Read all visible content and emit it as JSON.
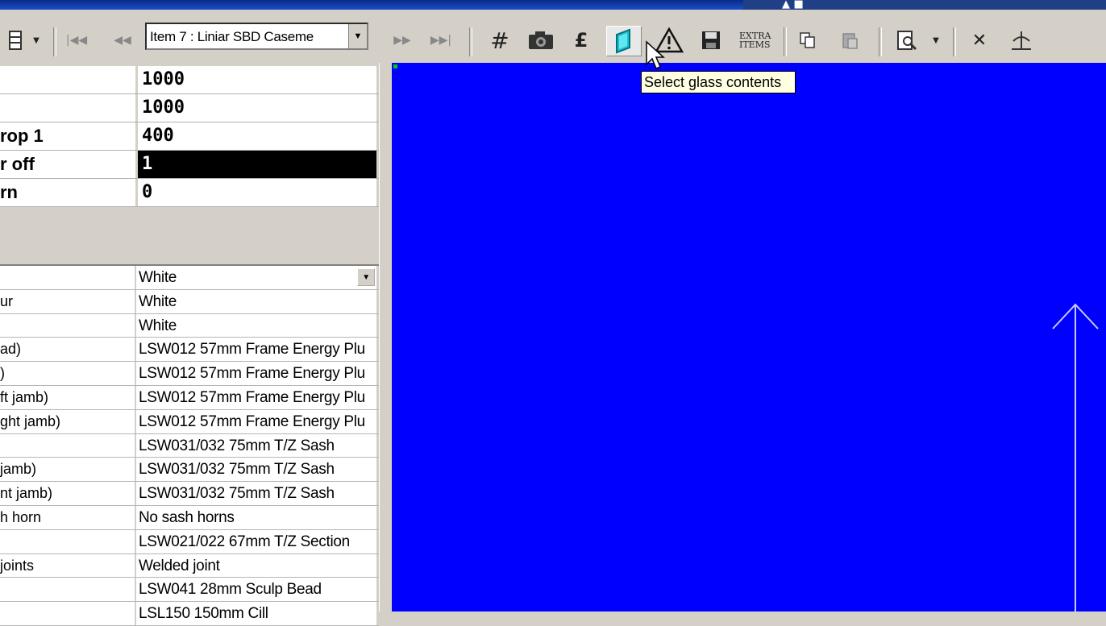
{
  "toolbar": {
    "item_selector_value": "Item 7 : Liniar SBD Caseme",
    "extra_items_label": "EXTRA ITEMS",
    "currency_symbol": "£",
    "tooltip": "Select glass contents"
  },
  "dimensions_table": {
    "rows": [
      {
        "label": "",
        "value": "1000"
      },
      {
        "label": "",
        "value": "1000"
      },
      {
        "label": "rop 1",
        "value": "400"
      },
      {
        "label": "r off",
        "value": "1"
      },
      {
        "label": "rn",
        "value": "0"
      }
    ],
    "selected_row_index": 3
  },
  "properties_table": {
    "rows": [
      {
        "label": "",
        "value": "White"
      },
      {
        "label": "ur",
        "value": "White"
      },
      {
        "label": "",
        "value": "White"
      },
      {
        "label": "ad)",
        "value": "LSW012 57mm Frame Energy Plu"
      },
      {
        "label": ")",
        "value": "LSW012 57mm Frame Energy Plu"
      },
      {
        "label": "ft jamb)",
        "value": "LSW012 57mm Frame Energy Plu"
      },
      {
        "label": "ght jamb)",
        "value": "LSW012 57mm Frame Energy Plu"
      },
      {
        "label": "",
        "value": "LSW031/032 75mm T/Z Sash"
      },
      {
        "label": " jamb)",
        "value": "LSW031/032 75mm T/Z Sash"
      },
      {
        "label": "nt jamb)",
        "value": "LSW031/032 75mm T/Z Sash"
      },
      {
        "label": "h horn",
        "value": "No sash horns"
      },
      {
        "label": "",
        "value": "LSW021/022 67mm T/Z Section"
      },
      {
        "label": " joints",
        "value": "Welded joint"
      },
      {
        "label": "",
        "value": "LSW041 28mm Sculp Bead"
      },
      {
        "label": "",
        "value": "LSL150 150mm Cill"
      }
    ]
  },
  "canvas": {
    "background": "#0000ff"
  }
}
